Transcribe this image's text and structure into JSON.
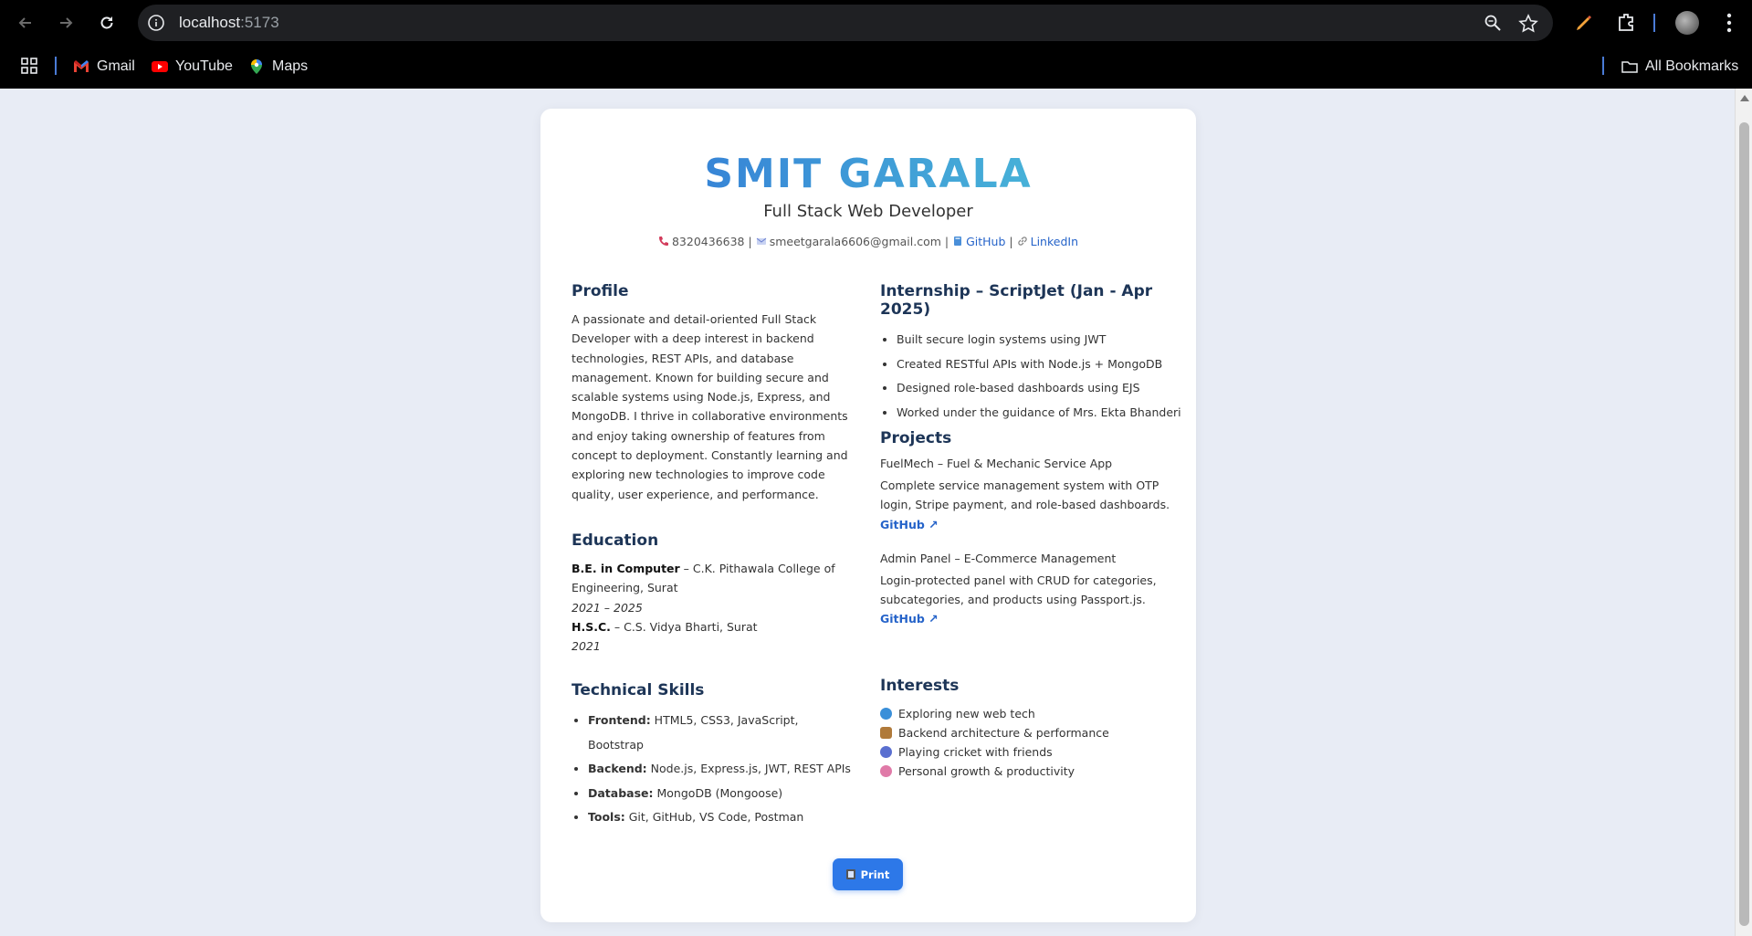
{
  "browser": {
    "url_host": "localhost",
    "url_port": ":5173",
    "bookmarks": [
      {
        "label": "Gmail",
        "icon": "gmail-icon"
      },
      {
        "label": "YouTube",
        "icon": "youtube-icon"
      },
      {
        "label": "Maps",
        "icon": "maps-icon"
      }
    ],
    "all_bookmarks": "All Bookmarks"
  },
  "resume": {
    "name": "SMIT GARALA",
    "role": "Full Stack Web Developer",
    "contact": {
      "phone": "8320436638",
      "email": "smeetgarala6606@gmail.com",
      "github": "GitHub",
      "linkedin": "LinkedIn",
      "sep": "|"
    },
    "profile": {
      "heading": "Profile",
      "text": "A passionate and detail-oriented Full Stack Developer with a deep interest in backend technologies, REST APIs, and database management. Known for building secure and scalable systems using Node.js, Express, and MongoDB. I thrive in collaborative environments and enjoy taking ownership of features from concept to deployment. Constantly learning and exploring new technologies to improve code quality, user experience, and performance."
    },
    "education": {
      "heading": "Education",
      "items": [
        {
          "degree": "B.E. in Computer",
          "detail": " – C.K. Pithawala College of Engineering, Surat",
          "years": "2021 – 2025"
        },
        {
          "degree": "H.S.C.",
          "detail": " – C.S. Vidya Bharti, Surat",
          "years": "2021"
        }
      ]
    },
    "skills": {
      "heading": "Technical Skills",
      "items": [
        {
          "label": "Frontend:",
          "value": " HTML5, CSS3, JavaScript, Bootstrap"
        },
        {
          "label": "Backend:",
          "value": " Node.js, Express.js, JWT, REST APIs"
        },
        {
          "label": "Database:",
          "value": " MongoDB (Mongoose)"
        },
        {
          "label": "Tools:",
          "value": " Git, GitHub, VS Code, Postman"
        }
      ]
    },
    "internship": {
      "heading": "Internship – ScriptJet (Jan - Apr 2025)",
      "items": [
        "Built secure login systems using JWT",
        "Created RESTful APIs with Node.js + MongoDB",
        "Designed role-based dashboards using EJS",
        "Worked under the guidance of Mrs. Ekta Bhanderi"
      ]
    },
    "projects": {
      "heading": "Projects",
      "items": [
        {
          "title": "FuelMech – Fuel & Mechanic Service App",
          "desc": "Complete service management system with OTP login, Stripe payment, and role-based dashboards.",
          "link": "GitHub ↗"
        },
        {
          "title": "Admin Panel – E-Commerce Management",
          "desc": "Login-protected panel with CRUD for categories, subcategories, and products using Passport.js.",
          "link": "GitHub ↗"
        }
      ]
    },
    "interests": {
      "heading": "Interests",
      "items": [
        {
          "text": "Exploring new web tech",
          "icon": "globe-icon",
          "color": "#3a8fd9"
        },
        {
          "text": "Backend architecture & performance",
          "icon": "package-icon",
          "color": "#b07a3a"
        },
        {
          "text": "Playing cricket with friends",
          "icon": "cricket-icon",
          "color": "#5a6fd0"
        },
        {
          "text": "Personal growth & productivity",
          "icon": "brain-icon",
          "color": "#e07aa8"
        }
      ]
    },
    "print_label": "Print"
  }
}
